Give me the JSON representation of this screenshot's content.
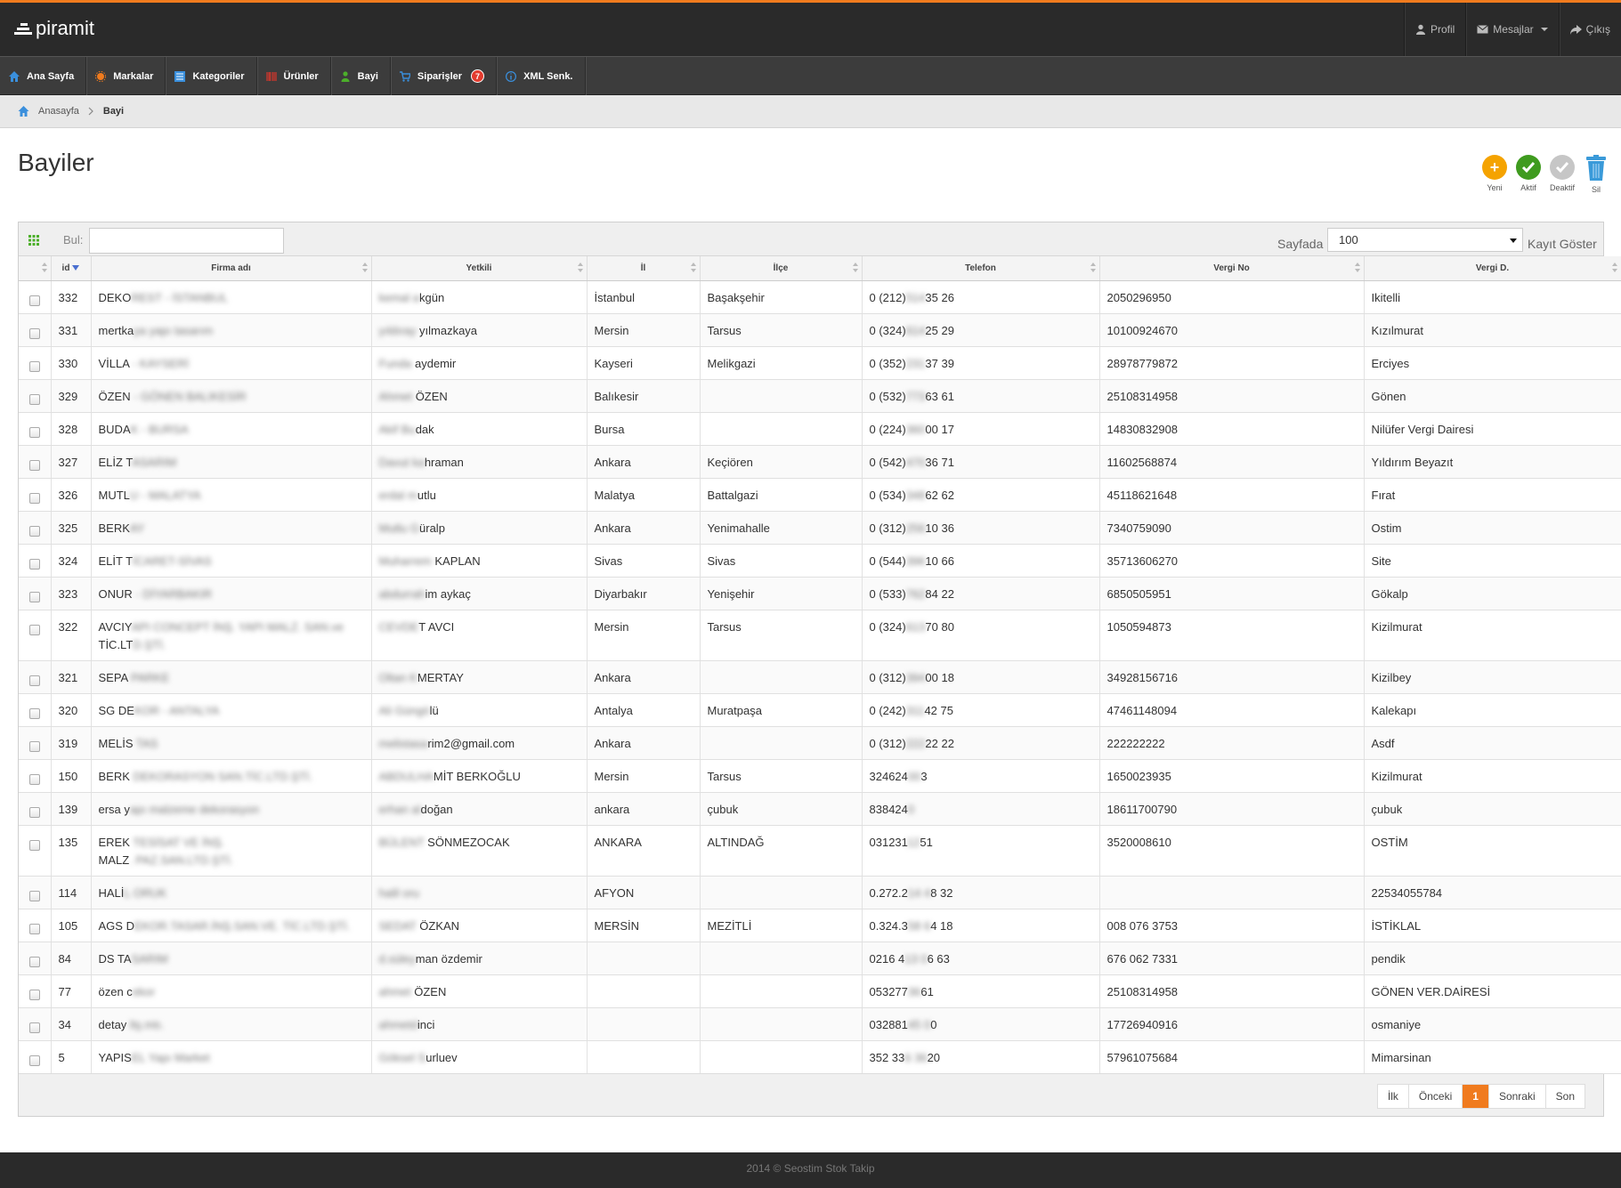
{
  "app": {
    "logo": "piramit",
    "top_links": [
      {
        "icon": "user-icon",
        "label": "Profil"
      },
      {
        "icon": "envelope-icon",
        "label": "Mesajlar"
      },
      {
        "icon": "share-icon",
        "label": "Çıkış"
      }
    ]
  },
  "nav": [
    {
      "icon": "home-icon",
      "label": "Ana Sayfa",
      "color": "#3a8fdc"
    },
    {
      "icon": "sun-icon",
      "label": "Markalar",
      "color": "#f07b1e"
    },
    {
      "icon": "list-icon",
      "label": "Kategoriler",
      "color": "#3a8fdc"
    },
    {
      "icon": "barcode-icon",
      "label": "Ürünler",
      "color": "#d8362b"
    },
    {
      "icon": "person-icon",
      "label": "Bayi",
      "color": "#4caf2a"
    },
    {
      "icon": "cart-icon",
      "label": "Siparişler",
      "color": "#3a8fdc",
      "badge": "7"
    },
    {
      "icon": "info-icon",
      "label": "XML Senk.",
      "color": "#3a8fdc"
    }
  ],
  "breadcrumb": {
    "home": "Anasayfa",
    "current": "Bayi"
  },
  "page": {
    "title": "Bayiler"
  },
  "actions": [
    {
      "icon": "plus-icon",
      "label": "Yeni",
      "color": "#f5a300"
    },
    {
      "icon": "check-icon",
      "label": "Aktif",
      "color": "#3f9b1f"
    },
    {
      "icon": "check-gray-icon",
      "label": "Deaktif",
      "color": "#c6c6c6"
    },
    {
      "icon": "trash-icon",
      "label": "Sil",
      "color": "#3a9ad9"
    }
  ],
  "toolbar": {
    "search_label": "Bul:",
    "search_value": "",
    "per_page_label": "Sayfada",
    "per_page_value": "100",
    "show_label": "Kayıt Göster"
  },
  "table": {
    "columns": [
      "id",
      "Firma adı",
      "Yetkili",
      "İl",
      "İlçe",
      "Telefon",
      "Vergi No",
      "Vergi D."
    ],
    "rows": [
      {
        "id": "332",
        "firma_vis": "DEKO",
        "firma_blur": "REST - İSTANBUL",
        "firma_vis2": "",
        "firma_blur2": "",
        "yet_blur": "kemal a",
        "yet_vis": "kgün",
        "il": "İstanbul",
        "ilce": "Başakşehir",
        "tel_vis": "0 (212)",
        "tel_blur": "514",
        "tel_vis2": "35 26",
        "vergi_no": "2050296950",
        "vergi_d": "Ikitelli"
      },
      {
        "id": "331",
        "firma_vis": "mertka",
        "firma_blur": "ya yapı tasarım",
        "firma_vis2": "",
        "firma_blur2": "",
        "yet_blur": "yıldıray ",
        "yet_vis": "yılmazkaya",
        "il": "Mersin",
        "ilce": "Tarsus",
        "tel_vis": "0 (324)",
        "tel_blur": "614",
        "tel_vis2": "25 29",
        "vergi_no": "10100924670",
        "vergi_d": "Kızılmurat"
      },
      {
        "id": "330",
        "firma_vis": "VİLLA",
        "firma_blur": " - KAYSERİ",
        "firma_vis2": "",
        "firma_blur2": "",
        "yet_blur": "Funda ",
        "yet_vis": "aydemir",
        "il": "Kayseri",
        "ilce": "Melikgazi",
        "tel_vis": "0 (352)",
        "tel_blur": "231",
        "tel_vis2": "37 39",
        "vergi_no": "28978779872",
        "vergi_d": "Erciyes"
      },
      {
        "id": "329",
        "firma_vis": "ÖZEN",
        "firma_blur": " - GÖNEN BALIKESİR",
        "firma_vis2": "",
        "firma_blur2": "",
        "yet_blur": "Ahmet ",
        "yet_vis": "ÖZEN",
        "il": "Balıkesir",
        "ilce": "",
        "tel_vis": "0 (532)",
        "tel_blur": "773",
        "tel_vis2": "63 61",
        "vergi_no": "25108314958",
        "vergi_d": "Gönen"
      },
      {
        "id": "328",
        "firma_vis": "BUDA",
        "firma_blur": "K - BURSA",
        "firma_vis2": "",
        "firma_blur2": "",
        "yet_blur": "Akif Bu",
        "yet_vis": "dak",
        "il": "Bursa",
        "ilce": "",
        "tel_vis": "0 (224)",
        "tel_blur": "360",
        "tel_vis2": "00 17",
        "vergi_no": "14830832908",
        "vergi_d": "Nilüfer Vergi Dairesi"
      },
      {
        "id": "327",
        "firma_vis": "ELİZ T",
        "firma_blur": "ASARIM",
        "firma_vis2": "",
        "firma_blur2": "",
        "yet_blur": "Davut ka",
        "yet_vis": "hraman",
        "il": "Ankara",
        "ilce": "Keçiören",
        "tel_vis": "0 (542)",
        "tel_blur": "470",
        "tel_vis2": "36 71",
        "vergi_no": "11602568874",
        "vergi_d": "Yıldırım Beyazıt"
      },
      {
        "id": "326",
        "firma_vis": "MUTL",
        "firma_blur": "U - MALATYA",
        "firma_vis2": "",
        "firma_blur2": "",
        "yet_blur": "erdal m",
        "yet_vis": "utlu",
        "il": "Malatya",
        "ilce": "Battalgazi",
        "tel_vis": "0 (534)",
        "tel_blur": "348",
        "tel_vis2": "62 62",
        "vergi_no": "45118621648",
        "vergi_d": "Fırat"
      },
      {
        "id": "325",
        "firma_vis": "BERK",
        "firma_blur": "AY",
        "firma_vis2": "",
        "firma_blur2": "",
        "yet_blur": "Mutlu G",
        "yet_vis": "üralp",
        "il": "Ankara",
        "ilce": "Yenimahalle",
        "tel_vis": "0 (312)",
        "tel_blur": "256",
        "tel_vis2": "10 36",
        "vergi_no": "7340759090",
        "vergi_d": "Ostim"
      },
      {
        "id": "324",
        "firma_vis": "ELİT T",
        "firma_blur": "İCARET-SİVAS",
        "firma_vis2": "",
        "firma_blur2": "",
        "yet_blur": "Muharrem ",
        "yet_vis": "KAPLAN",
        "il": "Sivas",
        "ilce": "Sivas",
        "tel_vis": "0 (544)",
        "tel_blur": "396",
        "tel_vis2": "10 66",
        "vergi_no": "35713606270",
        "vergi_d": "Site"
      },
      {
        "id": "323",
        "firma_vis": "ONUR",
        "firma_blur": " - DİYARBAKIR",
        "firma_vis2": "",
        "firma_blur2": "",
        "yet_blur": "abdurrah",
        "yet_vis": "im aykaç",
        "il": "Diyarbakır",
        "ilce": "Yenişehir",
        "tel_vis": "0 (533)",
        "tel_blur": "762",
        "tel_vis2": "84 22",
        "vergi_no": "6850505951",
        "vergi_d": "Gökalp"
      },
      {
        "id": "322",
        "firma_vis": "AVCIY",
        "firma_blur": "API CONCEPT İNŞ. YAPI MALZ. SAN.ve",
        "firma_vis2": "TİC.LT",
        "firma_blur2": "D.ŞTİ.",
        "yet_blur": "CEVDE",
        "yet_vis": "T AVCI",
        "il": "Mersin",
        "ilce": "Tarsus",
        "tel_vis": "0 (324)",
        "tel_blur": "613",
        "tel_vis2": "70 80",
        "vergi_no": "1050594873",
        "vergi_d": "Kizilmurat",
        "tall": true
      },
      {
        "id": "321",
        "firma_vis": "SEPA",
        "firma_blur": " PARKE",
        "firma_vis2": "",
        "firma_blur2": "",
        "yet_blur": "Oltan K",
        "yet_vis": "MERTAY",
        "il": "Ankara",
        "ilce": "",
        "tel_vis": "0 (312)",
        "tel_blur": "394",
        "tel_vis2": "00 18",
        "vergi_no": "34928156716",
        "vergi_d": "Kizilbey"
      },
      {
        "id": "320",
        "firma_vis": "SG DE",
        "firma_blur": "KOR - ANTALYA",
        "firma_vis2": "",
        "firma_blur2": "",
        "yet_blur": "Ali Güngö",
        "yet_vis": "lü",
        "il": "Antalya",
        "ilce": "Muratpaşa",
        "tel_vis": "0 (242)",
        "tel_blur": "311",
        "tel_vis2": "42 75",
        "vergi_no": "47461148094",
        "vergi_d": "Kalekapı"
      },
      {
        "id": "319",
        "firma_vis": "MELİS",
        "firma_blur": " TAS",
        "firma_vis2": "",
        "firma_blur2": "",
        "yet_blur": "melistasa",
        "yet_vis": "rim2@gmail.com",
        "il": "Ankara",
        "ilce": "",
        "tel_vis": "0 (312)",
        "tel_blur": "222",
        "tel_vis2": "22 22",
        "vergi_no": "222222222",
        "vergi_d": "Asdf"
      },
      {
        "id": "150",
        "firma_vis": "BERK",
        "firma_blur": " DEKORASYON SAN.TİC.LTD.ŞTİ.",
        "firma_vis2": "",
        "firma_blur2": "",
        "yet_blur": "ABDULHA",
        "yet_vis": "MİT BERKOĞLU",
        "il": "Mersin",
        "ilce": "Tarsus",
        "tel_vis": "324624",
        "tel_blur": "00",
        "tel_vis2": "3",
        "vergi_no": "1650023935",
        "vergi_d": "Kizilmurat"
      },
      {
        "id": "139",
        "firma_vis": "ersa y",
        "firma_blur": "apı malzeme dekorasyon",
        "firma_vis2": "",
        "firma_blur2": "",
        "yet_blur": "erhan al",
        "yet_vis": "doğan",
        "il": "ankara",
        "ilce": "çubuk",
        "tel_vis": "838424",
        "tel_blur": "0",
        "tel_vis2": "",
        "vergi_no": "18611700790",
        "vergi_d": "çubuk"
      },
      {
        "id": "135",
        "firma_vis": "EREK",
        "firma_blur": " TESİSAT VE İNŞ.",
        "firma_vis2": "MALZ",
        "firma_blur2": ". PAZ.SAN.LTD.ŞTİ.",
        "yet_blur": "BÜLENT",
        "yet_vis": " SÖNMEZOCAK",
        "il": "ANKARA",
        "ilce": "ALTINDAĞ",
        "tel_vis": "031231",
        "tel_blur": "12",
        "tel_vis2": "51",
        "vergi_no": "3520008610",
        "vergi_d": "OSTİM",
        "tall": true
      },
      {
        "id": "114",
        "firma_vis": "HALİ",
        "firma_blur": "L ORUK",
        "firma_vis2": "",
        "firma_blur2": "",
        "yet_blur": "halil oru",
        "yet_vis": "",
        "il": "AFYON",
        "ilce": "",
        "tel_vis": "0.272.2",
        "tel_blur": "14 4",
        "tel_vis2": "8 32",
        "vergi_no": "",
        "vergi_d": "22534055784"
      },
      {
        "id": "105",
        "firma_vis": "AGS D",
        "firma_blur": "EKOR.TASAR.İNŞ.SAN.VE. TİC.LTD.ŞTİ.",
        "firma_vis2": "",
        "firma_blur2": "",
        "yet_blur": "SEDAT ",
        "yet_vis": "ÖZKAN",
        "il": "MERSİN",
        "ilce": "MEZİTLİ",
        "tel_vis": "0.324.3",
        "tel_blur": "58 6",
        "tel_vis2": "4 18",
        "vergi_no": "008 076 3753",
        "vergi_d": "İSTİKLAL"
      },
      {
        "id": "84",
        "firma_vis": "DS TA",
        "firma_blur": "SARIM",
        "firma_vis2": "",
        "firma_blur2": "",
        "yet_blur": "d.süley",
        "yet_vis": "man özdemir",
        "il": "",
        "ilce": "",
        "tel_vis": "0216 4",
        "tel_blur": "13 0",
        "tel_vis2": "6 63",
        "vergi_no": "676 062 7331",
        "vergi_d": "pendik"
      },
      {
        "id": "77",
        "firma_vis": "özen c",
        "firma_blur": "ekor",
        "firma_vis2": "",
        "firma_blur2": "",
        "yet_blur": "ahmet ",
        "yet_vis": "ÖZEN",
        "il": "",
        "ilce": "",
        "tel_vis": "053277",
        "tel_blur": "36",
        "tel_vis2": "61",
        "vergi_no": "25108314958",
        "vergi_d": "GÖNEN VER.DAİRESİ"
      },
      {
        "id": "34",
        "firma_vis": "detay",
        "firma_blur": " ltş.mtı.",
        "firma_vis2": "",
        "firma_blur2": "",
        "yet_blur": "ahmetd",
        "yet_vis": "inci",
        "il": "",
        "ilce": "",
        "tel_vis": "032881",
        "tel_blur": "45 0",
        "tel_vis2": "0",
        "vergi_no": "17726940916",
        "vergi_d": "osmaniye"
      },
      {
        "id": "5",
        "firma_vis": "YAPIS",
        "firma_blur": "EL Yapı Market",
        "firma_vis2": "",
        "firma_blur2": "",
        "yet_blur": "Göksel S",
        "yet_vis": "urluev",
        "il": "",
        "ilce": "",
        "tel_vis": "352 33",
        "tel_blur": "6 36",
        "tel_vis2": "20",
        "vergi_no": "57961075684",
        "vergi_d": "Mimarsinan"
      }
    ]
  },
  "pagination": {
    "first": "İlk",
    "prev": "Önceki",
    "current": "1",
    "next": "Sonraki",
    "last": "Son"
  },
  "footer": {
    "text": "2014 © Seostim Stok Takip"
  }
}
